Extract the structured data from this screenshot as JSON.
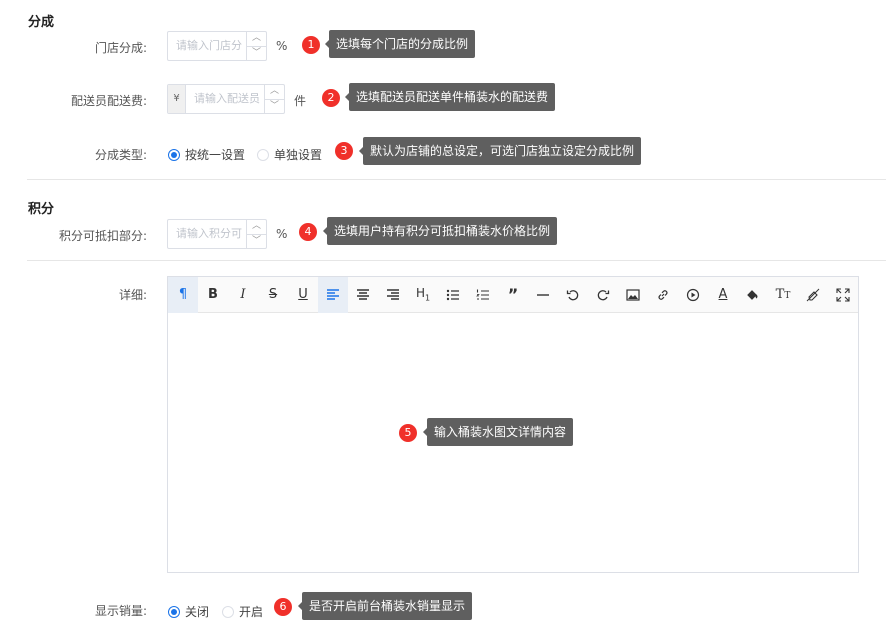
{
  "sections": {
    "commission_title": "分成",
    "points_title": "积分"
  },
  "store_share": {
    "label": "门店分成:",
    "placeholder": "请输入门店分",
    "unit": "%",
    "badge": "1",
    "tip": "选填每个门店的分成比例"
  },
  "delivery_fee": {
    "label": "配送员配送费:",
    "prefix": "¥",
    "placeholder": "请输入配送员",
    "unit": "件",
    "badge": "2",
    "tip": "选填配送员配送单件桶装水的配送费"
  },
  "share_type": {
    "label": "分成类型:",
    "options": [
      "按统一设置",
      "单独设置"
    ],
    "selected": "按统一设置",
    "badge": "3",
    "tip": "默认为店铺的总设定，可选门店独立设定分成比例"
  },
  "points_deduct": {
    "label": "积分可抵扣部分:",
    "placeholder": "请输入积分可",
    "unit": "%",
    "badge": "4",
    "tip": "选填用户持有积分可抵扣桶装水价格比例"
  },
  "details": {
    "label": "详细:",
    "badge": "5",
    "tip": "输入桶装水图文详情内容",
    "toolbar": [
      "paragraph-icon",
      "bold-icon",
      "italic-icon",
      "strikethrough-icon",
      "underline-icon",
      "align-left-icon",
      "align-center-icon",
      "align-right-icon",
      "heading-icon",
      "bullet-list-icon",
      "ordered-list-icon",
      "quote-icon",
      "horizontal-rule-icon",
      "undo-icon",
      "redo-icon",
      "image-icon",
      "link-icon",
      "video-icon",
      "font-color-icon",
      "fill-color-icon",
      "font-size-icon",
      "clear-format-icon",
      "fullscreen-icon"
    ]
  },
  "show_sales": {
    "label": "显示销量:",
    "options": [
      "关闭",
      "开启"
    ],
    "selected": "关闭",
    "badge": "6",
    "tip": "是否开启前台桶装水销量显示"
  },
  "colors": {
    "accent": "#1a73e8",
    "badge": "#f0302a",
    "tip_bg": "#5f5f5f"
  }
}
